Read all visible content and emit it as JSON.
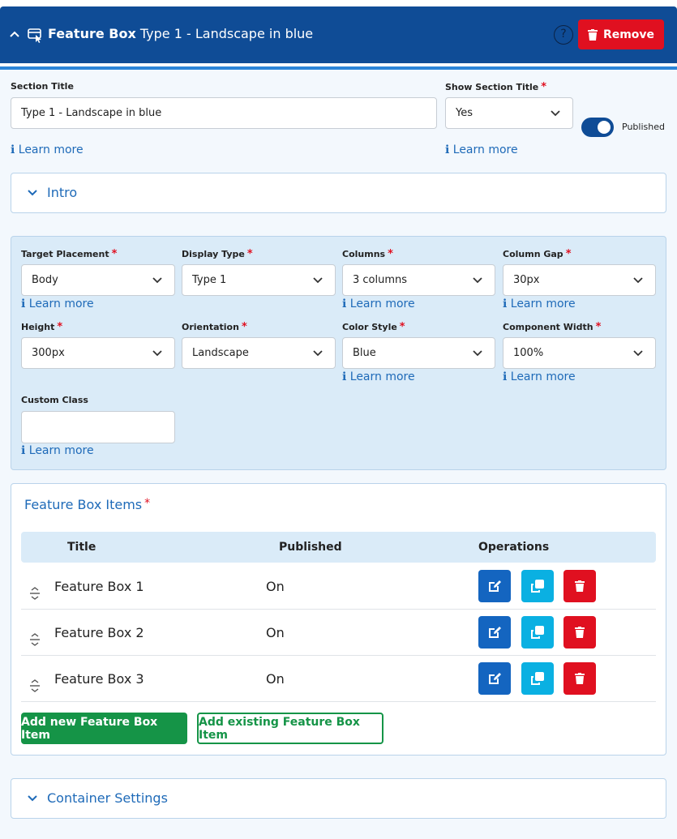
{
  "header": {
    "block_name": "Feature Box",
    "block_subtitle": "Type 1 - Landscape in blue",
    "help_label": "?",
    "remove_label": "Remove"
  },
  "section": {
    "title_label": "Section Title",
    "title_value": "Type 1 - Landscape in blue",
    "show_title_label": "Show Section Title",
    "show_title_value": "Yes",
    "published_label": "Published",
    "published": true,
    "learn_more": "ℹ Learn more"
  },
  "intro": {
    "label": "Intro"
  },
  "settings": {
    "target_placement": {
      "label": "Target Placement",
      "value": "Body"
    },
    "display_type": {
      "label": "Display Type",
      "value": "Type 1"
    },
    "columns": {
      "label": "Columns",
      "value": "3 columns"
    },
    "column_gap": {
      "label": "Column Gap",
      "value": "30px"
    },
    "height": {
      "label": "Height",
      "value": "300px"
    },
    "orientation": {
      "label": "Orientation",
      "value": "Landscape"
    },
    "color_style": {
      "label": "Color Style",
      "value": "Blue"
    },
    "component_width": {
      "label": "Component Width",
      "value": "100%"
    },
    "custom_class": {
      "label": "Custom Class",
      "value": ""
    },
    "required_mark": "*"
  },
  "items": {
    "heading": "Feature Box Items",
    "columns": [
      "Title",
      "Published",
      "Operations"
    ],
    "rows": [
      {
        "title": "Feature Box 1",
        "published": "On"
      },
      {
        "title": "Feature Box 2",
        "published": "On"
      },
      {
        "title": "Feature Box 3",
        "published": "On"
      }
    ],
    "add_new_label": "Add new Feature Box Item",
    "add_existing_label": "Add existing Feature Box Item"
  },
  "container": {
    "label": "Container Settings"
  },
  "colors": {
    "header_bg": "#0f4c96",
    "remove_red": "#e01020",
    "link_blue": "#1e6ab8",
    "add_green": "#159447",
    "edit_blue": "#1465c0",
    "copy_cyan": "#0ab0e2"
  },
  "icons": {
    "collapse": "chevron-up-icon",
    "block": "block-cursor-icon",
    "remove": "trash-icon",
    "expand": "chevron-down-icon",
    "drag": "drag-handle-icon",
    "edit": "edit-icon",
    "copy": "copy-icon",
    "delete": "trash-icon"
  }
}
